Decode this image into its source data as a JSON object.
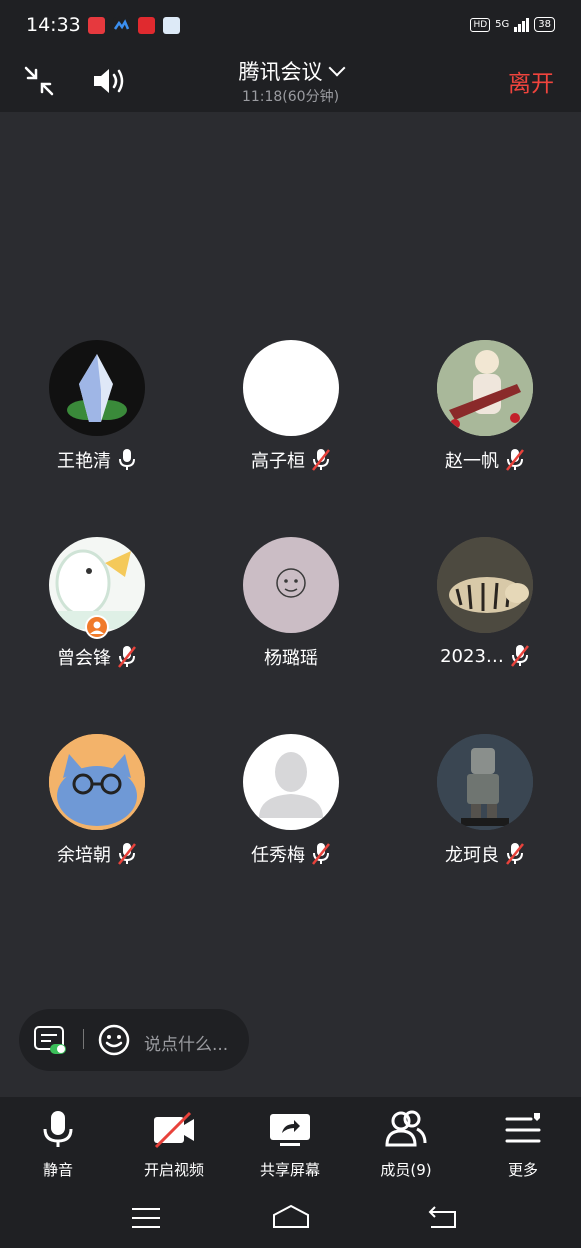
{
  "status_bar": {
    "time": "14:33",
    "network_hd": "HD",
    "network_gen": "5G",
    "battery": "38"
  },
  "header": {
    "title": "腾讯会议",
    "duration": "11:18(60分钟)",
    "leave_label": "离开"
  },
  "participants": [
    {
      "name": "王艳清",
      "mic": "on",
      "avatar": "crystal-avatar"
    },
    {
      "name": "高子桓",
      "mic": "muted",
      "avatar": "blank-avatar"
    },
    {
      "name": "赵一帆",
      "mic": "muted",
      "avatar": "guitar-photo-avatar"
    },
    {
      "name": "曾会锋",
      "mic": "muted",
      "avatar": "duck-avatar",
      "host": true
    },
    {
      "name": "杨璐瑶",
      "mic": "none",
      "avatar": "doodle-avatar"
    },
    {
      "name": "2023…",
      "mic": "muted",
      "avatar": "tiger-avatar"
    },
    {
      "name": "余培朝",
      "mic": "muted",
      "avatar": "cat-avatar"
    },
    {
      "name": "任秀梅",
      "mic": "muted",
      "avatar": "default-person-avatar"
    },
    {
      "name": "龙珂良",
      "mic": "muted",
      "avatar": "robot-figure-avatar"
    }
  ],
  "chat": {
    "placeholder": "说点什么..."
  },
  "toolbar": {
    "mute_label": "静音",
    "video_label": "开启视频",
    "share_label": "共享屏幕",
    "members_label": "成员(9)",
    "more_label": "更多"
  },
  "colors": {
    "background": "#2b2c30",
    "bar": "#1f2023",
    "leave": "#f0443d",
    "muted_slash": "#e8423b"
  }
}
